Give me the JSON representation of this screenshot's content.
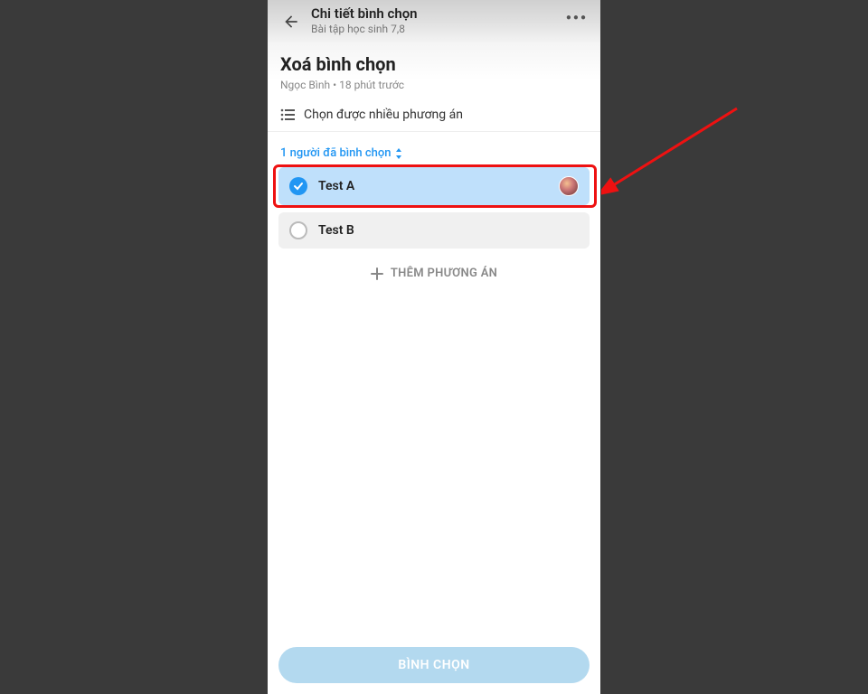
{
  "header": {
    "title": "Chi tiết bình chọn",
    "subtitle": "Bài tập học sinh 7,8"
  },
  "poll": {
    "title": "Xoá bình chọn",
    "author": "Ngọc Bình",
    "time": "18 phút trước",
    "multi_label": "Chọn được nhiều phương án",
    "voters_text": "1 người đã bình chọn",
    "options": [
      {
        "label": "Test A",
        "selected": true
      },
      {
        "label": "Test B",
        "selected": false
      }
    ],
    "add_option_label": "THÊM PHƯƠNG ÁN"
  },
  "footer": {
    "vote_button": "BÌNH CHỌN"
  }
}
